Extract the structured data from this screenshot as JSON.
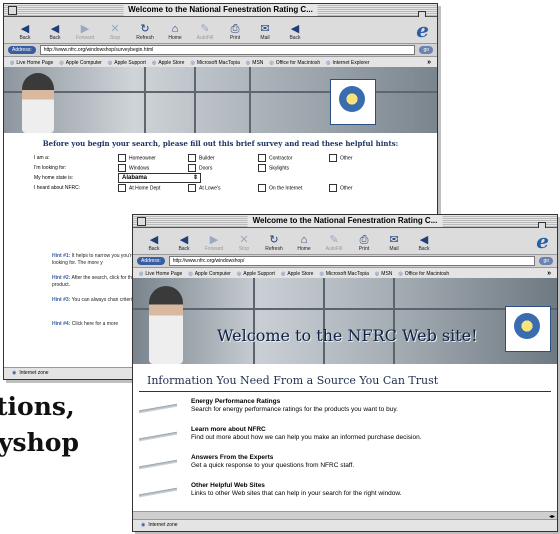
{
  "toolbar_buttons": [
    {
      "icon": "back-arrow-icon",
      "glyph": "◀",
      "label": "Back",
      "dim": false
    },
    {
      "icon": "back-arrow-icon",
      "glyph": "◀",
      "label": "Back",
      "dim": false
    },
    {
      "icon": "forward-arrow-icon",
      "glyph": "▶",
      "label": "Forward",
      "dim": true
    },
    {
      "icon": "stop-icon",
      "glyph": "✕",
      "label": "Stop",
      "dim": true
    },
    {
      "icon": "refresh-icon",
      "glyph": "↻",
      "label": "Refresh",
      "dim": false
    },
    {
      "icon": "home-icon",
      "glyph": "⌂",
      "label": "Home",
      "dim": false
    },
    {
      "icon": "autofill-icon",
      "glyph": "✎",
      "label": "AutoFill",
      "dim": true
    },
    {
      "icon": "print-icon",
      "glyph": "⎙",
      "label": "Print",
      "dim": false
    },
    {
      "icon": "mail-icon",
      "glyph": "✉",
      "label": "Mail",
      "dim": false
    },
    {
      "icon": "back-arrow-icon",
      "glyph": "◀",
      "label": "Back",
      "dim": false
    }
  ],
  "windowA": {
    "title": "Welcome to the National Fenestration Rating C...",
    "address_label": "Address:",
    "url": "http://www.nfrc.org/windowshop/surveybegin.html",
    "go": "go",
    "favorites": [
      "Live Home Page",
      "Apple Computer",
      "Apple Support",
      "Apple Store",
      "Microsoft MacTopia",
      "MSN",
      "Office for Macintosh",
      "Internet Explorer"
    ],
    "survey": {
      "heading": "Before you begin your search, please fill out this brief survey and read these helpful hints:",
      "i_am_label": "I am a:",
      "i_am_options": [
        "Homeowner",
        "Builder",
        "Contractor",
        "Other"
      ],
      "looking_label": "I'm looking for:",
      "looking_options": [
        "Windows",
        "Doors",
        "Skylights"
      ],
      "state_label": "My home state is:",
      "state_value": "Alabama",
      "heard_label": "I heard about NFRC:",
      "heard_options": [
        "At Home Dept",
        "At Lowe's",
        "On the Internet",
        "Other"
      ]
    },
    "hints": [
      {
        "label": "Hint #1:",
        "text": "It helps to narrow you you're looking for. The more y"
      },
      {
        "label": "Hint #2:",
        "text": "After the search, click for that product."
      },
      {
        "label": "Hint #3:",
        "text": "You can always chan criteria."
      },
      {
        "label": "Hint #4:",
        "text": "Click here for a more"
      }
    ],
    "status": "Internet zone"
  },
  "windowB": {
    "title": "Welcome to the National Fenestration Rating C...",
    "address_label": "Address:",
    "url": "http://www.nfrc.org/windowshop/",
    "go": "go",
    "favorites": [
      "Live Home Page",
      "Apple Computer",
      "Apple Support",
      "Apple Store",
      "Microsoft MacTopia",
      "MSN",
      "Office for Macintosh"
    ],
    "banner_text": "Welcome to the NFRC Web site!",
    "info_heading": "Information You Need From a Source You Can Trust",
    "items": [
      {
        "title": "Energy Performance Ratings",
        "desc": "Search for energy performance ratings for the products you want to buy."
      },
      {
        "title": "Learn more about NFRC",
        "desc": "Find out more about how we can help you make an informed purchase decision."
      },
      {
        "title": "Answers From the Experts",
        "desc": "Get a quick response to your questions from NFRC staff."
      },
      {
        "title": "Other Helpful Web Sites",
        "desc": "Links to other Web sites that can help in your search for the right window."
      }
    ],
    "status": "Internet zone"
  },
  "caption_lines": [
    "tions,",
    "yshop"
  ]
}
